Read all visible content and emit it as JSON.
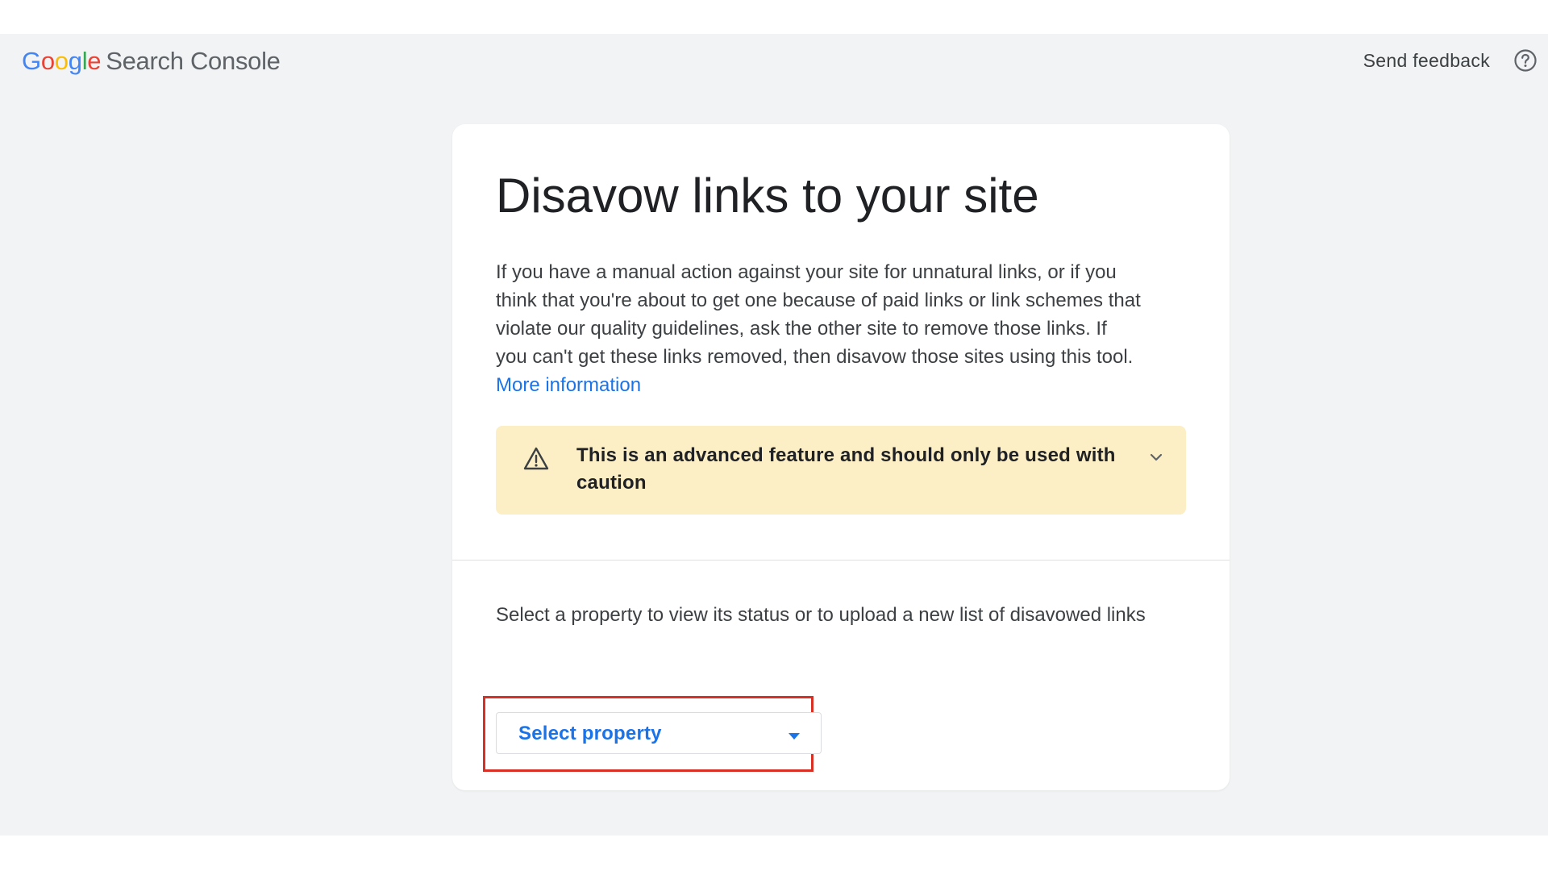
{
  "header": {
    "logo_letters": [
      "G",
      "o",
      "o",
      "g",
      "l",
      "e"
    ],
    "product_name": "Search Console",
    "send_feedback_label": "Send feedback",
    "help_icon": "help-circle-icon"
  },
  "card": {
    "title": "Disavow links to your site",
    "description": "If you have a manual action against your site for unnatural links, or if you think that you're about to get one because of paid links or link schemes that violate our quality guidelines, ask the other site to remove those links. If you can't get these links removed, then disavow those sites using this tool.",
    "more_info_link": "More information",
    "warning": {
      "icon": "warning-triangle-icon",
      "text": "This is an advanced feature and should only be used with caution",
      "expand_icon": "chevron-down-icon"
    },
    "select_prompt": "Select a property to view its status or to upload a new list of disavowed links",
    "select_property": {
      "label": "Select property",
      "arrow_icon": "dropdown-arrow-icon"
    }
  },
  "colors": {
    "background": "#f1f3f4",
    "card": "#ffffff",
    "accent_blue": "#1a73e8",
    "warning_bg": "#fcefc6",
    "highlight_red": "#d93025",
    "google_blue": "#4285f4",
    "google_red": "#ea4335",
    "google_yellow": "#fbbc05",
    "google_green": "#34a853"
  }
}
